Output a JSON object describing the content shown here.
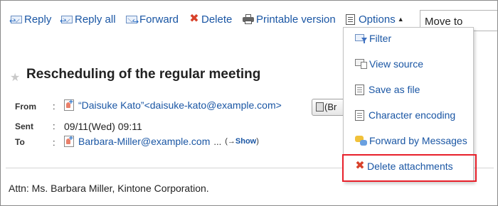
{
  "toolbar": {
    "reply": "Reply",
    "reply_all": "Reply all",
    "forward": "Forward",
    "delete": "Delete",
    "printable": "Printable version",
    "options": "Options",
    "move_to": "Move to"
  },
  "message": {
    "subject": "Rescheduling of the regular meeting",
    "from_label": "From",
    "from_value": "“Daisuke Kato”<daisuke-kato@example.com>",
    "sent_label": "Sent",
    "sent_value": "09/11(Wed) 09:11",
    "to_label": "To",
    "to_value": "Barbara-Miller@example.com",
    "to_more": "...",
    "show_prefix": "(→",
    "show_link": "Show",
    "show_suffix": ")",
    "address_button": "(Br",
    "colon": ":",
    "body": "Attn: Ms. Barbara Miller, Kintone Corporation."
  },
  "options_menu": {
    "items": [
      {
        "label": "Filter",
        "icon": "filter-icon"
      },
      {
        "label": "View source",
        "icon": "view-source-icon"
      },
      {
        "label": "Save as file",
        "icon": "file-icon"
      },
      {
        "label": "Character encoding",
        "icon": "file-icon"
      },
      {
        "label": "Forward by Messages",
        "icon": "messages-icon"
      },
      {
        "label": "Delete attachments",
        "icon": "delete-icon"
      }
    ],
    "highlight_color": "#e8202a"
  },
  "colors": {
    "link": "#1a56a4",
    "delete_icon": "#d8412a"
  }
}
